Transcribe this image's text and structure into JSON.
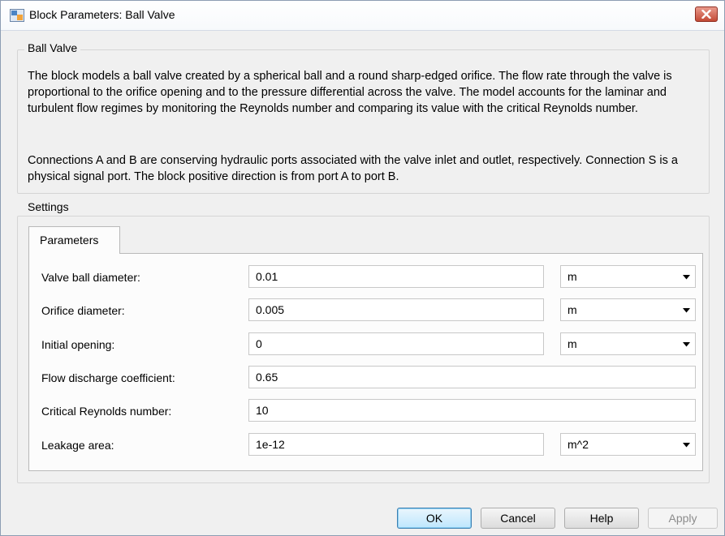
{
  "window": {
    "title": "Block Parameters: Ball Valve"
  },
  "block": {
    "group_label": "Ball Valve",
    "description_1": "The block models a ball valve created by a spherical ball and a round sharp-edged orifice. The flow rate through the valve is proportional to the orifice opening and to the pressure differential across the valve. The model accounts for the laminar and turbulent flow regimes by monitoring the Reynolds number and comparing its value with the critical Reynolds number.",
    "description_2": "Connections A and B are conserving hydraulic ports associated with the valve inlet and outlet, respectively. Connection S is a physical signal port. The block positive direction is from port A to port B."
  },
  "settings": {
    "group_label": "Settings",
    "tab_label": "Parameters",
    "params": [
      {
        "label": "Valve ball diameter:",
        "value": "0.01",
        "unit": "m"
      },
      {
        "label": "Orifice diameter:",
        "value": "0.005",
        "unit": "m"
      },
      {
        "label": "Initial opening:",
        "value": "0",
        "unit": "m"
      },
      {
        "label": "Flow discharge coefficient:",
        "value": "0.65"
      },
      {
        "label": "Critical Reynolds number:",
        "value": "10"
      },
      {
        "label": "Leakage area:",
        "value": "1e-12",
        "unit": "m^2"
      }
    ]
  },
  "buttons": {
    "ok": "OK",
    "cancel": "Cancel",
    "help": "Help",
    "apply": "Apply"
  },
  "icons": {
    "app": "simulink-block-icon",
    "close": "close-icon",
    "dropdown": "chevron-down-icon"
  },
  "colors": {
    "close_button": "#c34a36",
    "primary_button_border": "#3c7fb1",
    "window_bg": "#f0f0f0"
  }
}
